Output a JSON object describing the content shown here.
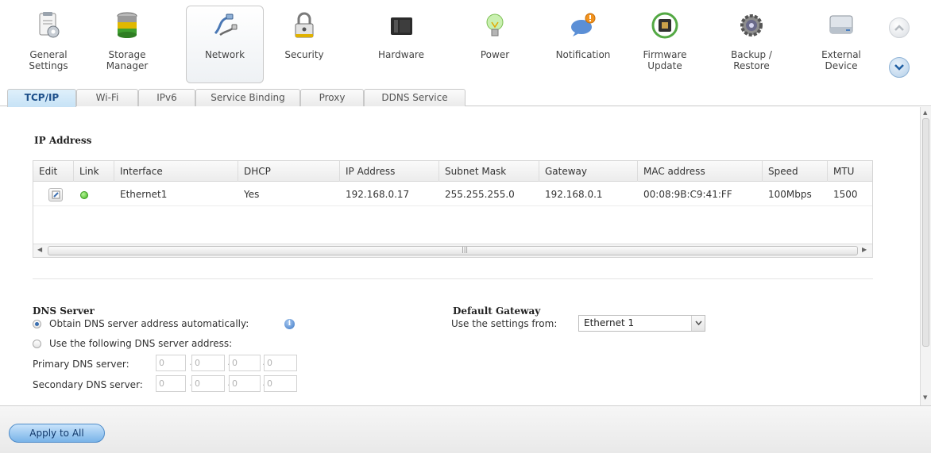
{
  "toolbar": {
    "items": [
      {
        "label": "General\nSettings",
        "icon": "general-settings-icon"
      },
      {
        "label": "Storage\nManager",
        "icon": "storage-manager-icon"
      },
      {
        "label": "Network",
        "icon": "network-icon",
        "active": true
      },
      {
        "label": "Security",
        "icon": "lock-icon"
      },
      {
        "label": "Hardware",
        "icon": "hardware-icon"
      },
      {
        "label": "Power",
        "icon": "power-bulb-icon"
      },
      {
        "label": "Notification",
        "icon": "notification-icon"
      },
      {
        "label": "Firmware\nUpdate",
        "icon": "firmware-chip-icon"
      },
      {
        "label": "Backup /\nRestore",
        "icon": "backup-gear-icon"
      },
      {
        "label": "External\nDevice",
        "icon": "external-drive-icon"
      }
    ]
  },
  "tabs": [
    {
      "label": "TCP/IP",
      "active": true
    },
    {
      "label": "Wi-Fi"
    },
    {
      "label": "IPv6"
    },
    {
      "label": "Service Binding"
    },
    {
      "label": "Proxy"
    },
    {
      "label": "DDNS Service"
    }
  ],
  "ip_section": {
    "title": "IP Address",
    "columns": [
      "Edit",
      "Link",
      "Interface",
      "DHCP",
      "IP Address",
      "Subnet Mask",
      "Gateway",
      "MAC address",
      "Speed",
      "MTU"
    ],
    "rows": [
      {
        "interface": "Ethernet1",
        "dhcp": "Yes",
        "ip_address": "192.168.0.17",
        "subnet_mask": "255.255.255.0",
        "gateway": "192.168.0.1",
        "mac_address": "00:08:9B:C9:41:FF",
        "speed": "100Mbps",
        "mtu": "1500",
        "link_status": "up"
      }
    ]
  },
  "dns": {
    "title": "DNS Server",
    "option_auto": "Obtain DNS server address automatically:",
    "option_manual": "Use the following DNS server address:",
    "selected": "auto",
    "primary_label": "Primary DNS server:",
    "secondary_label": "Secondary DNS server:",
    "primary_values": [
      "0",
      "0",
      "0",
      "0"
    ],
    "secondary_values": [
      "0",
      "0",
      "0",
      "0"
    ]
  },
  "default_gateway": {
    "title": "Default Gateway",
    "label": "Use the settings from:",
    "selected": "Ethernet 1"
  },
  "footer": {
    "apply_label": "Apply to All"
  },
  "colors": {
    "accent": "#79b3e8",
    "active_tab": "#c6e2f6",
    "link_up": "#3fb31d"
  }
}
